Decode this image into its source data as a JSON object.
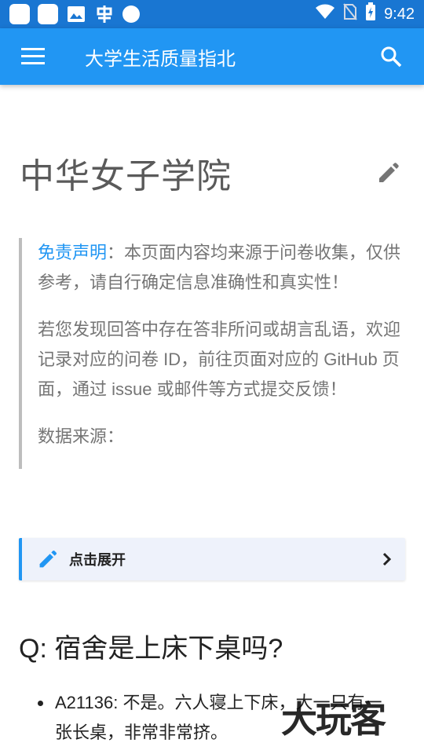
{
  "status_bar": {
    "time": "9:42",
    "icons": [
      "app-square-icon",
      "app-square-icon",
      "image-icon",
      "app-logo-icon",
      "circle-icon",
      "wifi-icon",
      "no-sim-icon",
      "battery-charging-icon"
    ]
  },
  "app_bar": {
    "title": "大学生活质量指北",
    "menu_icon": "menu-icon",
    "search_icon": "search-icon"
  },
  "page": {
    "title": "中华女子学院",
    "edit_icon": "pencil-icon"
  },
  "disclaimer": {
    "highlight": "免责声明",
    "para1_rest": "：本页面内容均来源于问卷收集，仅供参考，请自行确定信息准确性和真实性！",
    "para2": "若您发现回答中存在答非所问或胡言乱语，欢迎记录对应的问卷 ID，前往页面对应的 GitHub 页面，通过 issue 或邮件等方式提交反馈！",
    "para3": "数据来源："
  },
  "expand": {
    "label": "点击展开",
    "icon": "pencil-icon",
    "chevron": "chevron-right-icon"
  },
  "question": {
    "prefix": "Q:",
    "text": " 宿舍是上床下桌吗?"
  },
  "answers": [
    "A21136: 不是。六人寝上下床，大一只有一张长桌，非常非常挤。"
  ],
  "watermark": {
    "text": "大玩客"
  },
  "colors": {
    "status_bar": "#1976d2",
    "app_bar": "#2196f3",
    "accent": "#2196f3",
    "quote_border": "#bdbdbd",
    "expand_bg": "#eef2fb"
  }
}
